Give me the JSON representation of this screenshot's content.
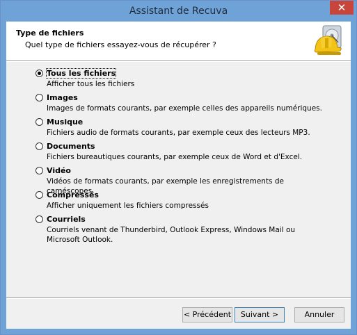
{
  "window": {
    "title": "Assistant de Recuva",
    "close_label": "✕"
  },
  "header": {
    "title": "Type de fichiers",
    "subtitle": "Quel type de fichiers essayez-vous de récupérer ?",
    "icon": "recuva-hardhat-disk-icon"
  },
  "options": [
    {
      "label": "Tous les fichiers",
      "description": "Afficher tous les fichiers",
      "selected": true
    },
    {
      "label": "Images",
      "description": "Images de formats courants, par exemple celles des appareils numériques.",
      "selected": false
    },
    {
      "label": "Musique",
      "description": "Fichiers audio de formats courants, par exemple ceux des lecteurs MP3.",
      "selected": false
    },
    {
      "label": "Documents",
      "description": "Fichiers bureautiques courants, par exemple ceux de Word et d'Excel.",
      "selected": false
    },
    {
      "label": "Vidéo",
      "description": "Vidéos de formats courants, par exemple les enregistrements de caméscopes.",
      "selected": false
    },
    {
      "label": "Compressés",
      "description": "Afficher uniquement les fichiers compressés",
      "selected": false
    },
    {
      "label": "Courriels",
      "description": "Courriels venant de Thunderbird, Outlook Express, Windows Mail ou Microsoft Outlook.",
      "selected": false
    }
  ],
  "buttons": {
    "back": "< Précédent",
    "next": "Suivant >",
    "cancel": "Annuler"
  },
  "colors": {
    "titlebar": "#6fa3d8",
    "close": "#c7453b",
    "dialog_bg": "#f0f0f0"
  }
}
